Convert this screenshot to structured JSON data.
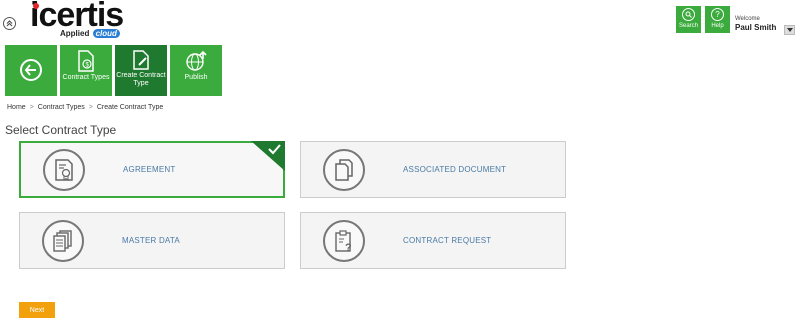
{
  "logo": {
    "brand": "icertis",
    "sub_prefix": "Applied",
    "sub_cloud": "cloud"
  },
  "header": {
    "search_label": "Search",
    "help_label": "Help",
    "welcome": "Welcome",
    "username": "Paul Smith"
  },
  "toolbar": {
    "items": [
      {
        "label": "",
        "icon": "back-arrow-icon"
      },
      {
        "label": "Contract Types",
        "icon": "contract-types-icon"
      },
      {
        "label": "Create Contract Type",
        "icon": "create-contract-type-icon"
      },
      {
        "label": "Publish",
        "icon": "globe-upload-icon"
      }
    ]
  },
  "breadcrumb": {
    "items": [
      "Home",
      "Contract Types",
      "Create Contract Type"
    ],
    "separator": ">"
  },
  "page": {
    "title": "Select Contract Type"
  },
  "contract_types": [
    {
      "label": "AGREEMENT",
      "icon": "certificate-document-icon",
      "selected": true
    },
    {
      "label": "ASSOCIATED DOCUMENT",
      "icon": "documents-stack-icon",
      "selected": false
    },
    {
      "label": "MASTER DATA",
      "icon": "data-sheets-icon",
      "selected": false
    },
    {
      "label": "CONTRACT REQUEST",
      "icon": "clipboard-question-icon",
      "selected": false
    }
  ],
  "actions": {
    "next_label": "Next"
  },
  "colors": {
    "accent_green": "#3aab3c",
    "active_green": "#1f7a2f",
    "next_orange": "#f2a10c",
    "label_blue": "#4a7aa6"
  }
}
